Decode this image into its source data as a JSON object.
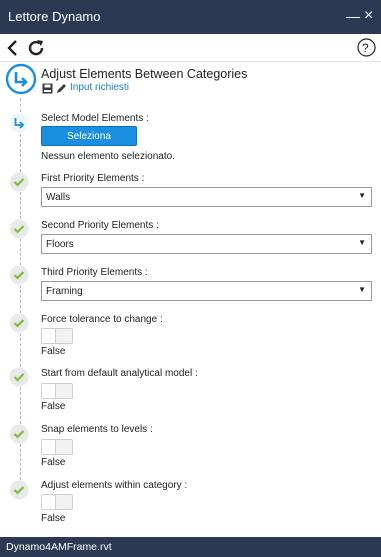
{
  "window": {
    "title": "Lettore Dynamo",
    "min_glyph": "—",
    "close_glyph": "×"
  },
  "toolbar": {
    "back_icon": "back-chevron-icon",
    "refresh_icon": "refresh-icon",
    "help_label": "?"
  },
  "script": {
    "title": "Adjust Elements Between Categories",
    "subtitle": "Input richiesti"
  },
  "select_model": {
    "label": "Select Model Elements :",
    "button_label": "Seleziona",
    "status": "Nessun elemento selezionato."
  },
  "first_priority": {
    "label": "First Priority Elements :",
    "value": "Walls"
  },
  "second_priority": {
    "label": "Second Priority Elements :",
    "value": "Floors"
  },
  "third_priority": {
    "label": "Third Priority Elements :",
    "value": "Framing"
  },
  "force_tolerance": {
    "label": "Force tolerance to change :",
    "value": "False",
    "on": false
  },
  "start_default": {
    "label": "Start from default analytical model :",
    "value": "False",
    "on": false
  },
  "snap_levels": {
    "label": "Snap elements to levels :",
    "value": "False",
    "on": false
  },
  "adjust_within": {
    "label": "Adjust elements within category :",
    "value": "False",
    "on": false
  },
  "status_bar": {
    "file": "Dynamo4AMFrame.rvt"
  },
  "colors": {
    "titlebar": "#2b3a52",
    "accent": "#1a8ee0",
    "check": "#7cbf3a"
  }
}
